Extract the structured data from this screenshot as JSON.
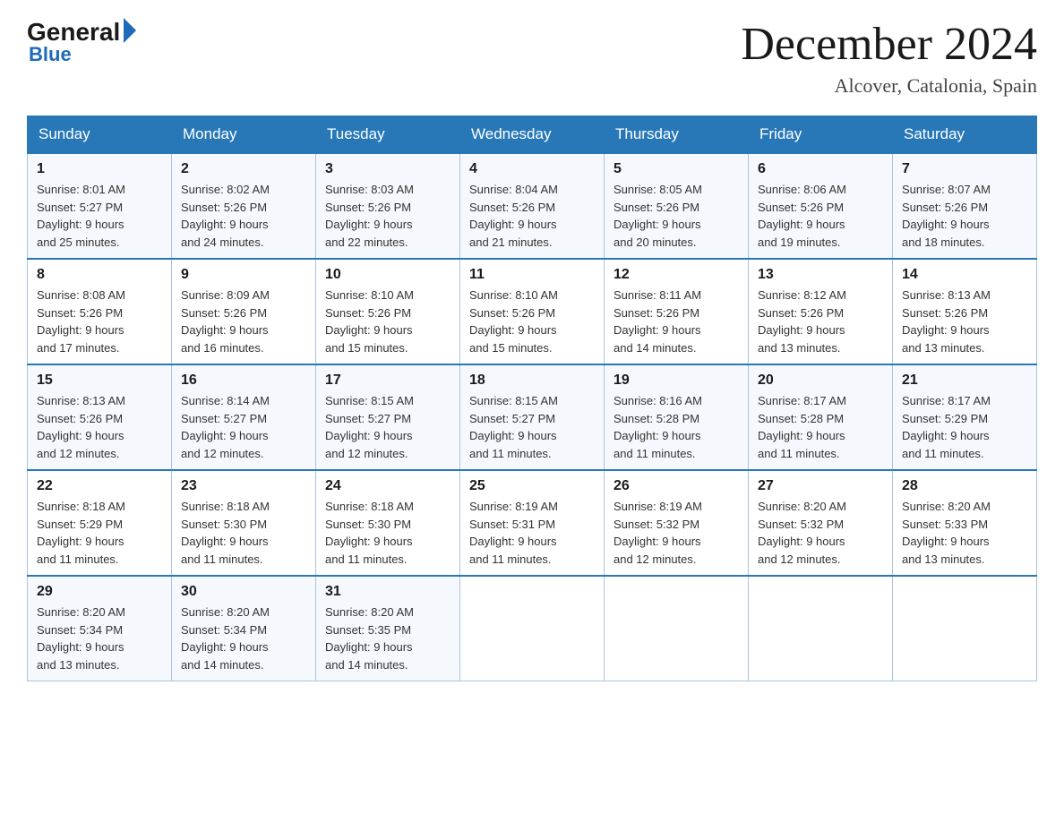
{
  "header": {
    "logo_general": "General",
    "logo_blue": "Blue",
    "month_title": "December 2024",
    "location": "Alcover, Catalonia, Spain"
  },
  "weekdays": [
    "Sunday",
    "Monday",
    "Tuesday",
    "Wednesday",
    "Thursday",
    "Friday",
    "Saturday"
  ],
  "weeks": [
    [
      {
        "day": "1",
        "sunrise": "8:01 AM",
        "sunset": "5:27 PM",
        "daylight": "9 hours and 25 minutes."
      },
      {
        "day": "2",
        "sunrise": "8:02 AM",
        "sunset": "5:26 PM",
        "daylight": "9 hours and 24 minutes."
      },
      {
        "day": "3",
        "sunrise": "8:03 AM",
        "sunset": "5:26 PM",
        "daylight": "9 hours and 22 minutes."
      },
      {
        "day": "4",
        "sunrise": "8:04 AM",
        "sunset": "5:26 PM",
        "daylight": "9 hours and 21 minutes."
      },
      {
        "day": "5",
        "sunrise": "8:05 AM",
        "sunset": "5:26 PM",
        "daylight": "9 hours and 20 minutes."
      },
      {
        "day": "6",
        "sunrise": "8:06 AM",
        "sunset": "5:26 PM",
        "daylight": "9 hours and 19 minutes."
      },
      {
        "day": "7",
        "sunrise": "8:07 AM",
        "sunset": "5:26 PM",
        "daylight": "9 hours and 18 minutes."
      }
    ],
    [
      {
        "day": "8",
        "sunrise": "8:08 AM",
        "sunset": "5:26 PM",
        "daylight": "9 hours and 17 minutes."
      },
      {
        "day": "9",
        "sunrise": "8:09 AM",
        "sunset": "5:26 PM",
        "daylight": "9 hours and 16 minutes."
      },
      {
        "day": "10",
        "sunrise": "8:10 AM",
        "sunset": "5:26 PM",
        "daylight": "9 hours and 15 minutes."
      },
      {
        "day": "11",
        "sunrise": "8:10 AM",
        "sunset": "5:26 PM",
        "daylight": "9 hours and 15 minutes."
      },
      {
        "day": "12",
        "sunrise": "8:11 AM",
        "sunset": "5:26 PM",
        "daylight": "9 hours and 14 minutes."
      },
      {
        "day": "13",
        "sunrise": "8:12 AM",
        "sunset": "5:26 PM",
        "daylight": "9 hours and 13 minutes."
      },
      {
        "day": "14",
        "sunrise": "8:13 AM",
        "sunset": "5:26 PM",
        "daylight": "9 hours and 13 minutes."
      }
    ],
    [
      {
        "day": "15",
        "sunrise": "8:13 AM",
        "sunset": "5:26 PM",
        "daylight": "9 hours and 12 minutes."
      },
      {
        "day": "16",
        "sunrise": "8:14 AM",
        "sunset": "5:27 PM",
        "daylight": "9 hours and 12 minutes."
      },
      {
        "day": "17",
        "sunrise": "8:15 AM",
        "sunset": "5:27 PM",
        "daylight": "9 hours and 12 minutes."
      },
      {
        "day": "18",
        "sunrise": "8:15 AM",
        "sunset": "5:27 PM",
        "daylight": "9 hours and 11 minutes."
      },
      {
        "day": "19",
        "sunrise": "8:16 AM",
        "sunset": "5:28 PM",
        "daylight": "9 hours and 11 minutes."
      },
      {
        "day": "20",
        "sunrise": "8:17 AM",
        "sunset": "5:28 PM",
        "daylight": "9 hours and 11 minutes."
      },
      {
        "day": "21",
        "sunrise": "8:17 AM",
        "sunset": "5:29 PM",
        "daylight": "9 hours and 11 minutes."
      }
    ],
    [
      {
        "day": "22",
        "sunrise": "8:18 AM",
        "sunset": "5:29 PM",
        "daylight": "9 hours and 11 minutes."
      },
      {
        "day": "23",
        "sunrise": "8:18 AM",
        "sunset": "5:30 PM",
        "daylight": "9 hours and 11 minutes."
      },
      {
        "day": "24",
        "sunrise": "8:18 AM",
        "sunset": "5:30 PM",
        "daylight": "9 hours and 11 minutes."
      },
      {
        "day": "25",
        "sunrise": "8:19 AM",
        "sunset": "5:31 PM",
        "daylight": "9 hours and 11 minutes."
      },
      {
        "day": "26",
        "sunrise": "8:19 AM",
        "sunset": "5:32 PM",
        "daylight": "9 hours and 12 minutes."
      },
      {
        "day": "27",
        "sunrise": "8:20 AM",
        "sunset": "5:32 PM",
        "daylight": "9 hours and 12 minutes."
      },
      {
        "day": "28",
        "sunrise": "8:20 AM",
        "sunset": "5:33 PM",
        "daylight": "9 hours and 13 minutes."
      }
    ],
    [
      {
        "day": "29",
        "sunrise": "8:20 AM",
        "sunset": "5:34 PM",
        "daylight": "9 hours and 13 minutes."
      },
      {
        "day": "30",
        "sunrise": "8:20 AM",
        "sunset": "5:34 PM",
        "daylight": "9 hours and 14 minutes."
      },
      {
        "day": "31",
        "sunrise": "8:20 AM",
        "sunset": "5:35 PM",
        "daylight": "9 hours and 14 minutes."
      },
      null,
      null,
      null,
      null
    ]
  ],
  "labels": {
    "sunrise": "Sunrise:",
    "sunset": "Sunset:",
    "daylight": "Daylight:"
  }
}
